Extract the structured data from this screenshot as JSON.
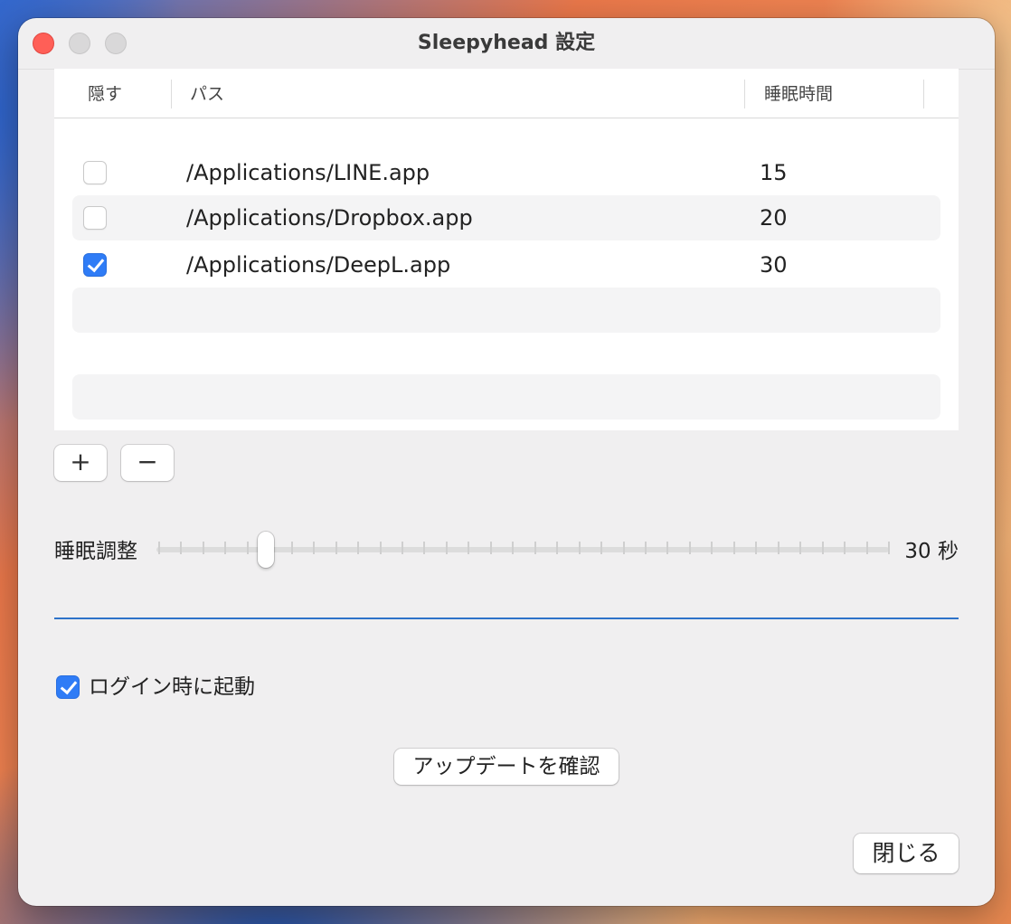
{
  "window": {
    "title": "Sleepyhead 設定"
  },
  "table": {
    "columns": [
      "隠す",
      "パス",
      "睡眠時間"
    ],
    "rows": [
      {
        "hide": false,
        "path": "/Applications/LINE.app",
        "sleep": "15"
      },
      {
        "hide": false,
        "path": "/Applications/Dropbox.app",
        "sleep": "20"
      },
      {
        "hide": true,
        "path": "/Applications/DeepL.app",
        "sleep": "30"
      }
    ]
  },
  "buttons": {
    "add": "+",
    "remove": "−",
    "check_update": "アップデートを確認",
    "close": "閉じる"
  },
  "slider": {
    "label": "睡眠調整",
    "value_text": "30 秒",
    "level": 0.148
  },
  "login": {
    "label": "ログイン時に起動",
    "checked": true
  },
  "colors": {
    "accent": "#2f7cf6",
    "divider": "#2e73c9",
    "close_light": "#ff5f57"
  }
}
